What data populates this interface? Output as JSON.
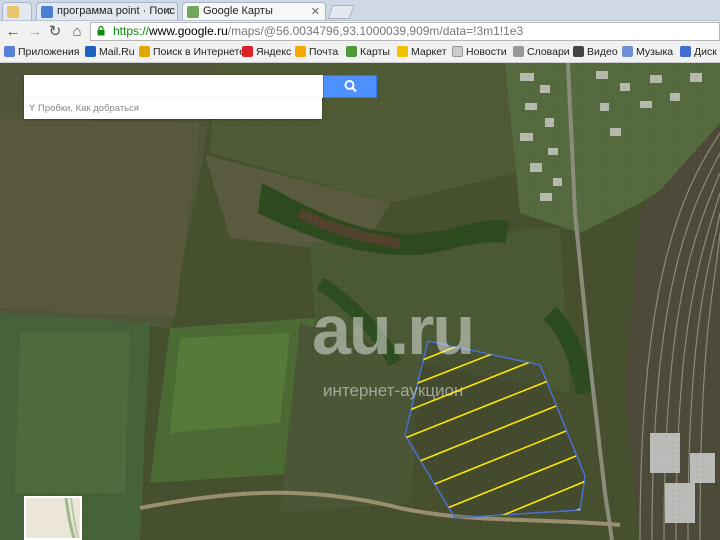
{
  "browser": {
    "tabs": [
      {
        "label": "",
        "active": false
      },
      {
        "label": "программа point · Поис",
        "active": false
      },
      {
        "label": "Google Карты",
        "active": true
      }
    ],
    "url": {
      "scheme": "https://",
      "host": "www.google.ru",
      "path": "/maps/@56.0034796,93.1000039,909m/data=!3m1!1e3"
    }
  },
  "bookmarks": [
    {
      "label": "Приложения",
      "icon": "apps-grid-icon",
      "color": "#5a7fd6"
    },
    {
      "label": "Mail.Ru",
      "icon": "mailru-icon",
      "color": "#1f5fbf"
    },
    {
      "label": "Поиск в Интернете",
      "icon": "search-globe-icon",
      "color": "#e0a800"
    },
    {
      "label": "Яндекс",
      "icon": "yandex-icon",
      "color": "#d9222a"
    },
    {
      "label": "Почта",
      "icon": "mail-icon",
      "color": "#f2a900"
    },
    {
      "label": "Карты",
      "icon": "maps-icon",
      "color": "#4a9a3a"
    },
    {
      "label": "Маркет",
      "icon": "market-icon",
      "color": "#f2c200"
    },
    {
      "label": "Новости",
      "icon": "news-icon",
      "color": "#cccccc"
    },
    {
      "label": "Словари",
      "icon": "dictionary-icon",
      "color": "#999999"
    },
    {
      "label": "Видео",
      "icon": "video-icon",
      "color": "#444444"
    },
    {
      "label": "Музыка",
      "icon": "music-icon",
      "color": "#6d8fd6"
    },
    {
      "label": "Диск",
      "icon": "disk-icon",
      "color": "#3f6fd0"
    }
  ],
  "map": {
    "search": {
      "value": "",
      "placeholder": ""
    },
    "directions_text": "Пробки, Как добраться",
    "view": "satellite"
  },
  "watermark": {
    "brand": "au.ru",
    "tagline": "интернет-аукцион"
  },
  "colors": {
    "search_button": "#4d90fe",
    "plot_outline": "#4a6fd1",
    "plot_hatch": "#ffe600"
  }
}
